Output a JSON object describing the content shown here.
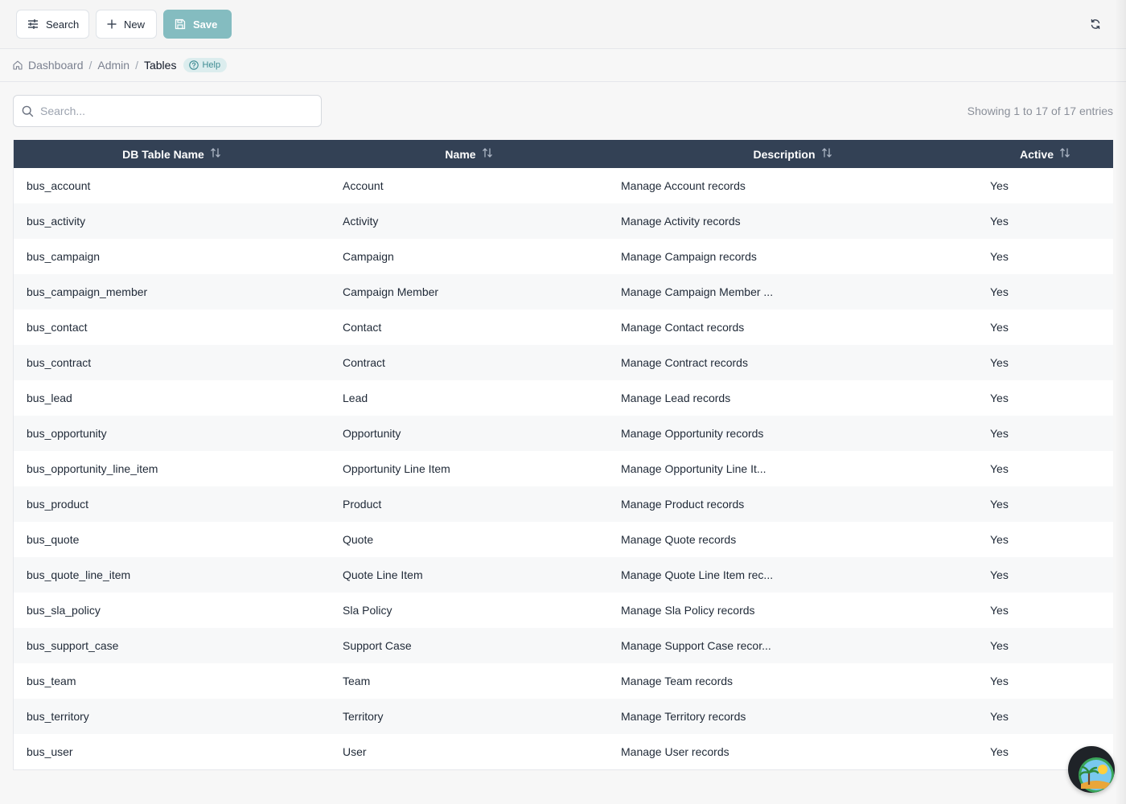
{
  "toolbar": {
    "search_label": "Search",
    "new_label": "New",
    "save_label": "Save"
  },
  "breadcrumb": {
    "items": [
      "Dashboard",
      "Admin",
      "Tables"
    ],
    "separator": "/",
    "help_label": "Help"
  },
  "search": {
    "placeholder": "Search...",
    "value": ""
  },
  "entries_info": "Showing 1 to 17 of 17 entries",
  "table": {
    "columns": [
      "DB Table Name",
      "Name",
      "Description",
      "Active"
    ],
    "rows": [
      [
        "bus_account",
        "Account",
        "Manage Account records",
        "Yes"
      ],
      [
        "bus_activity",
        "Activity",
        "Manage Activity records",
        "Yes"
      ],
      [
        "bus_campaign",
        "Campaign",
        "Manage Campaign records",
        "Yes"
      ],
      [
        "bus_campaign_member",
        "Campaign Member",
        "Manage Campaign Member ...",
        "Yes"
      ],
      [
        "bus_contact",
        "Contact",
        "Manage Contact records",
        "Yes"
      ],
      [
        "bus_contract",
        "Contract",
        "Manage Contract records",
        "Yes"
      ],
      [
        "bus_lead",
        "Lead",
        "Manage Lead records",
        "Yes"
      ],
      [
        "bus_opportunity",
        "Opportunity",
        "Manage Opportunity records",
        "Yes"
      ],
      [
        "bus_opportunity_line_item",
        "Opportunity Line Item",
        "Manage Opportunity Line It...",
        "Yes"
      ],
      [
        "bus_product",
        "Product",
        "Manage Product records",
        "Yes"
      ],
      [
        "bus_quote",
        "Quote",
        "Manage Quote records",
        "Yes"
      ],
      [
        "bus_quote_line_item",
        "Quote Line Item",
        "Manage Quote Line Item rec...",
        "Yes"
      ],
      [
        "bus_sla_policy",
        "Sla Policy",
        "Manage Sla Policy records",
        "Yes"
      ],
      [
        "bus_support_case",
        "Support Case",
        "Manage Support Case recor...",
        "Yes"
      ],
      [
        "bus_team",
        "Team",
        "Manage Team records",
        "Yes"
      ],
      [
        "bus_territory",
        "Territory",
        "Manage Territory records",
        "Yes"
      ],
      [
        "bus_user",
        "User",
        "Manage User records",
        "Yes"
      ]
    ]
  },
  "colors": {
    "header_bg": "#334155",
    "save_button": "#84bcc0",
    "help_badge_bg": "#dcedee",
    "help_badge_text": "#3f8c93"
  },
  "icons": {
    "search_button": "sliders-icon",
    "new_button": "plus-icon",
    "save_button": "floppy-disk-icon",
    "refresh": "refresh-icon",
    "breadcrumb_home": "home-icon",
    "help": "question-circle-icon",
    "search_field": "search-icon",
    "sort": "sort-arrows-icon",
    "chat": "chat-avatar-icon"
  }
}
